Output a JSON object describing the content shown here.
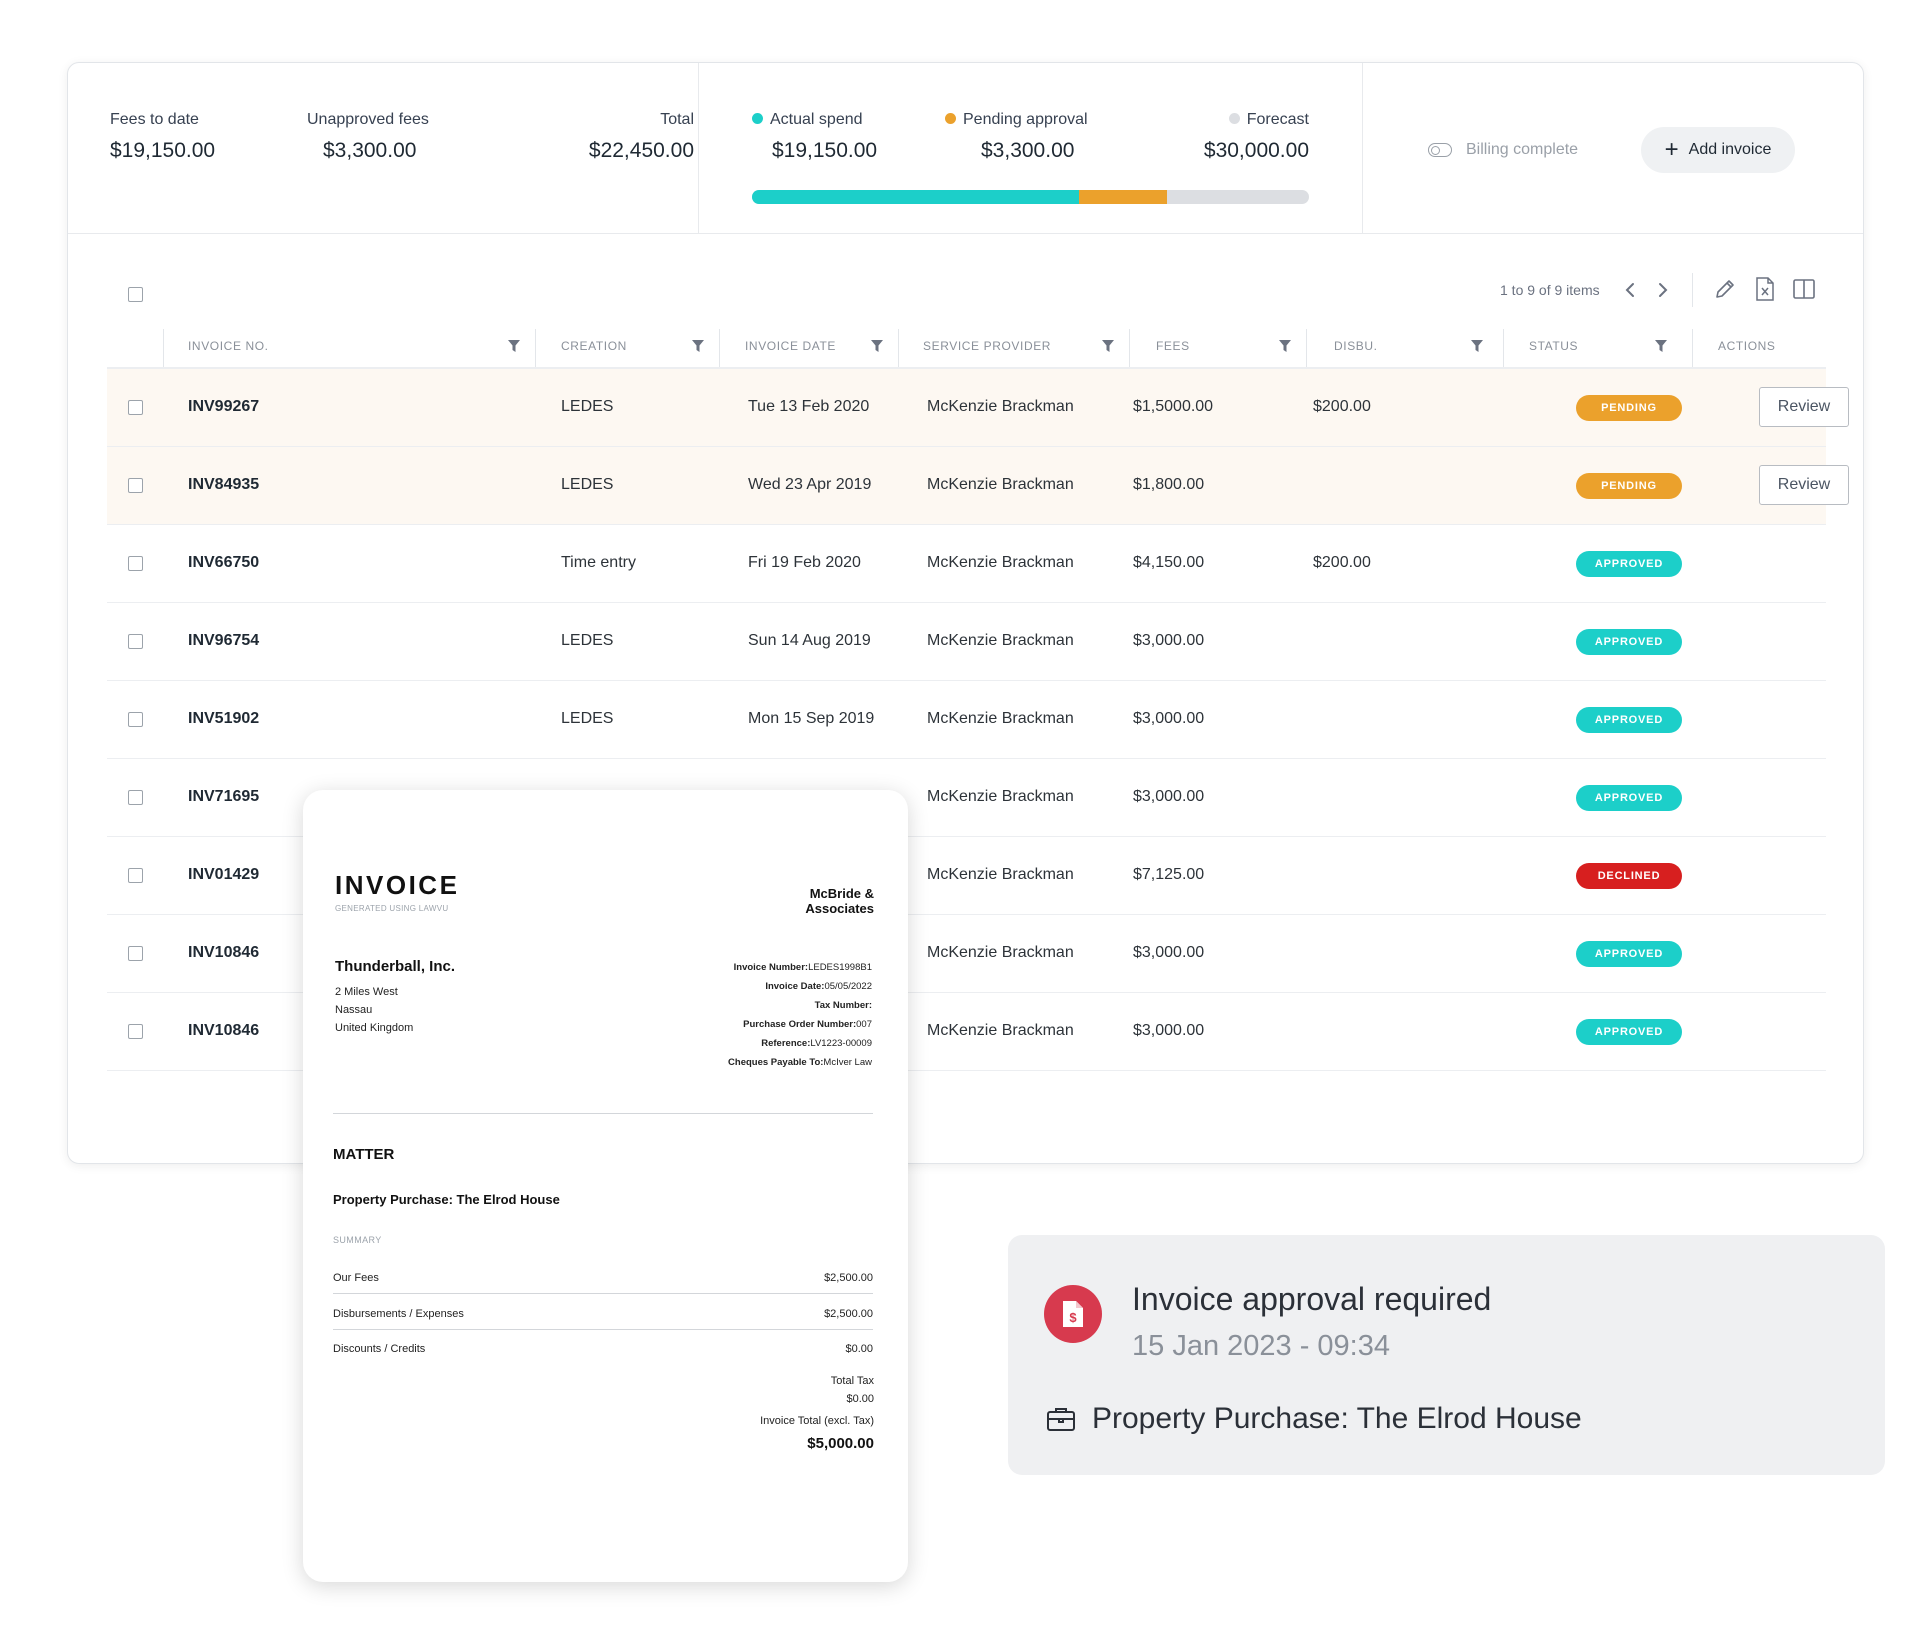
{
  "summary": {
    "fees_to_date_label": "Fees to date",
    "fees_to_date_value": "$19,150.00",
    "unapproved_label": "Unapproved fees",
    "unapproved_value": "$3,300.00",
    "total_label": "Total",
    "total_value": "$22,450.00"
  },
  "spend": {
    "actual_label": "Actual spend",
    "actual_value": "$19,150.00",
    "pending_label": "Pending approval",
    "pending_value": "$3,300.00",
    "forecast_label": "Forecast",
    "forecast_value": "$30,000.00",
    "actual_fraction": 0.5869,
    "pending_fraction": 0.1587,
    "colors": {
      "actual": "#1ccfc9",
      "pending": "#eba12c",
      "forecast": "#dcdee2"
    }
  },
  "billing_label": "Billing complete",
  "add_invoice_label": "Add invoice",
  "pager": {
    "text": "1 to 9 of 9 items"
  },
  "columns": [
    "Invoice No.",
    "Creation",
    "Invoice date",
    "Service provider",
    "Fees",
    "Disbu.",
    "Status",
    "Actions"
  ],
  "rows": [
    {
      "invoice": "INV99267",
      "creation": "LEDES",
      "date": "Tue 13 Feb 2020",
      "provider": "McKenzie Brackman",
      "fees": "$1,5000.00",
      "disbu": "$200.00",
      "status": "PENDING",
      "action": "Review",
      "highlight": true
    },
    {
      "invoice": "INV84935",
      "creation": "LEDES",
      "date": "Wed 23 Apr 2019",
      "provider": "McKenzie Brackman",
      "fees": "$1,800.00",
      "disbu": "",
      "status": "PENDING",
      "action": "Review",
      "highlight": true
    },
    {
      "invoice": "INV66750",
      "creation": "Time entry",
      "date": "Fri 19 Feb 2020",
      "provider": "McKenzie Brackman",
      "fees": "$4,150.00",
      "disbu": "$200.00",
      "status": "APPROVED",
      "action": "",
      "highlight": false
    },
    {
      "invoice": "INV96754",
      "creation": "LEDES",
      "date": "Sun 14 Aug 2019",
      "provider": "McKenzie Brackman",
      "fees": "$3,000.00",
      "disbu": "",
      "status": "APPROVED",
      "action": "",
      "highlight": false
    },
    {
      "invoice": "INV51902",
      "creation": "LEDES",
      "date": "Mon 15 Sep 2019",
      "provider": "McKenzie Brackman",
      "fees": "$3,000.00",
      "disbu": "",
      "status": "APPROVED",
      "action": "",
      "highlight": false
    },
    {
      "invoice": "INV71695",
      "creation": "",
      "date": "",
      "provider": "McKenzie Brackman",
      "fees": "$3,000.00",
      "disbu": "",
      "status": "APPROVED",
      "action": "",
      "highlight": false
    },
    {
      "invoice": "INV01429",
      "creation": "",
      "date": "",
      "provider": "McKenzie Brackman",
      "fees": "$7,125.00",
      "disbu": "",
      "status": "DECLINED",
      "action": "",
      "highlight": false
    },
    {
      "invoice": "INV10846",
      "creation": "",
      "date": "",
      "provider": "McKenzie Brackman",
      "fees": "$3,000.00",
      "disbu": "",
      "status": "APPROVED",
      "action": "",
      "highlight": false
    },
    {
      "invoice": "INV10846",
      "creation": "",
      "date": "",
      "provider": "McKenzie Brackman",
      "fees": "$3,000.00",
      "disbu": "",
      "status": "APPROVED",
      "action": "",
      "highlight": false
    }
  ],
  "status_colors": {
    "PENDING": "#eba12c",
    "APPROVED": "#1ccfc9",
    "DECLINED": "#d71f1f"
  },
  "invoice_doc": {
    "title": "INVOICE",
    "subtitle": "GENERATED USING LAWVU",
    "firm_line1": "McBride &",
    "firm_line2": "Associates",
    "client_name": "Thunderball, Inc.",
    "address_1": "2 Miles West",
    "address_2": "Nassau",
    "address_3": "United Kingdom",
    "meta": [
      {
        "label": "Invoice Number:",
        "value": "LEDES1998B1"
      },
      {
        "label": "Invoice Date:",
        "value": "05/05/2022"
      },
      {
        "label": "Tax Number:",
        "value": ""
      },
      {
        "label": "Purchase Order Number:",
        "value": "007"
      },
      {
        "label": "Reference:",
        "value": "LV1223-00009"
      },
      {
        "label": "Cheques Payable To:",
        "value": "McIver Law"
      }
    ],
    "matter_heading": "MATTER",
    "matter_name": "Property Purchase: The Elrod House",
    "summary_heading": "SUMMARY",
    "lines": [
      {
        "label": "Our Fees",
        "amount": "$2,500.00"
      },
      {
        "label": "Disbursements / Expenses",
        "amount": "$2,500.00"
      },
      {
        "label": "Discounts / Credits",
        "amount": "$0.00"
      }
    ],
    "total_tax_label": "Total Tax",
    "total_tax_value": "$0.00",
    "invoice_total_label": "Invoice Total (excl. Tax)",
    "invoice_total_value": "$5,000.00"
  },
  "notification": {
    "title": "Invoice approval required",
    "time": "15 Jan 2023 - 09:34",
    "matter": "Property Purchase: The Elrod House"
  }
}
